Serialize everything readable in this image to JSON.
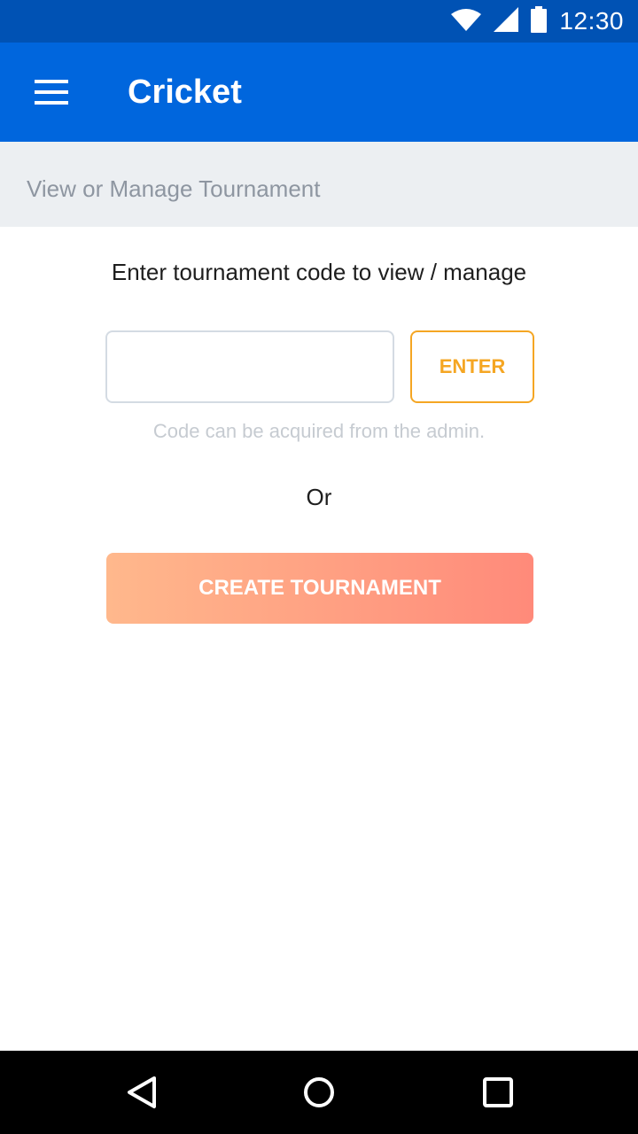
{
  "status_bar": {
    "time": "12:30",
    "icons": [
      "wifi-icon",
      "signal-icon",
      "battery-icon"
    ]
  },
  "app_bar": {
    "title": "Cricket",
    "menu_icon": "menu-icon"
  },
  "section": {
    "title": "View or Manage Tournament"
  },
  "main": {
    "prompt": "Enter tournament code to view / manage",
    "code_input": {
      "value": "",
      "placeholder": ""
    },
    "enter_label": "ENTER",
    "hint": "Code can be acquired from the admin.",
    "or_text": "Or",
    "create_label": "CREATE TOURNAMENT"
  },
  "nav_bar": {
    "icons": [
      "back-icon",
      "home-icon",
      "recents-icon"
    ]
  },
  "colors": {
    "status_bar": "#0052b4",
    "app_bar": "#0066dd",
    "accent_orange": "#f5a623",
    "gradient_start": "#ffb88c",
    "gradient_end": "#ff8a7a"
  }
}
